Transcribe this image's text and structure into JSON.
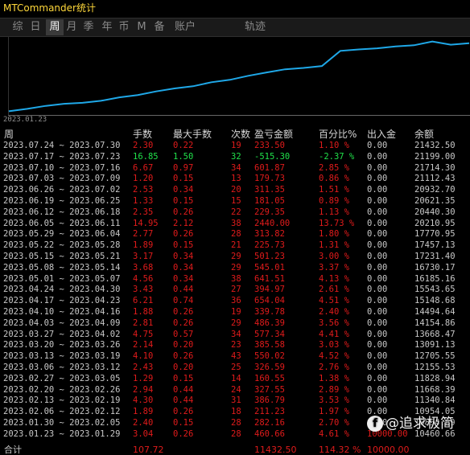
{
  "app": {
    "title": "MTCommander统计"
  },
  "tabs": [
    {
      "label": "综",
      "active": false
    },
    {
      "label": "日",
      "active": false
    },
    {
      "label": "周",
      "active": true
    },
    {
      "label": "月",
      "active": false
    },
    {
      "label": "季",
      "active": false
    },
    {
      "label": "年",
      "active": false
    },
    {
      "label": "币",
      "active": false
    },
    {
      "label": "M",
      "active": false
    },
    {
      "label": "备",
      "active": false
    },
    {
      "label": "账户",
      "active": false
    },
    {
      "label": "轨迹",
      "active": false
    }
  ],
  "chart": {
    "x_start_label": "2023.01.23",
    "line_color": "#1fa8e8",
    "balance_series": [
      10460.66,
      10854.69,
      11340.84,
      11668.39,
      11828.94,
      12155.53,
      12705.55,
      13091.13,
      13668.47,
      14154.86,
      14494.64,
      15148.68,
      15543.65,
      16185.16,
      16730.17,
      17231.4,
      17457.13,
      17770.95,
      20210.95,
      20440.3,
      20621.35,
      20932.7,
      21112.43,
      21714.3,
      21199.0,
      21432.5
    ]
  },
  "columns": {
    "week": "周",
    "lots": "手数",
    "max_lots": "最大手数",
    "count": "次数",
    "pnl": "盈亏金额",
    "percent": "百分比%",
    "deposit": "出入金",
    "balance": "余额"
  },
  "rows": [
    {
      "week": "2023.07.24 ~ 2023.07.30",
      "lots": "2.30",
      "max_lots": "0.22",
      "count": "19",
      "pnl": "233.50",
      "percent": "1.10 %",
      "deposit": "0.00",
      "balance": "21432.50",
      "color": "red"
    },
    {
      "week": "2023.07.17 ~ 2023.07.23",
      "lots": "16.85",
      "max_lots": "1.50",
      "count": "32",
      "pnl": "-515.30",
      "percent": "-2.37 %",
      "deposit": "0.00",
      "balance": "21199.00",
      "color": "green"
    },
    {
      "week": "2023.07.10 ~ 2023.07.16",
      "lots": "6.67",
      "max_lots": "0.97",
      "count": "34",
      "pnl": "601.87",
      "percent": "2.85 %",
      "deposit": "0.00",
      "balance": "21714.30",
      "color": "red"
    },
    {
      "week": "2023.07.03 ~ 2023.07.09",
      "lots": "1.20",
      "max_lots": "0.15",
      "count": "13",
      "pnl": "179.73",
      "percent": "0.86 %",
      "deposit": "0.00",
      "balance": "21112.43",
      "color": "red"
    },
    {
      "week": "2023.06.26 ~ 2023.07.02",
      "lots": "2.53",
      "max_lots": "0.34",
      "count": "20",
      "pnl": "311.35",
      "percent": "1.51 %",
      "deposit": "0.00",
      "balance": "20932.70",
      "color": "red"
    },
    {
      "week": "2023.06.19 ~ 2023.06.25",
      "lots": "1.33",
      "max_lots": "0.15",
      "count": "15",
      "pnl": "181.05",
      "percent": "0.89 %",
      "deposit": "0.00",
      "balance": "20621.35",
      "color": "red"
    },
    {
      "week": "2023.06.12 ~ 2023.06.18",
      "lots": "2.35",
      "max_lots": "0.26",
      "count": "22",
      "pnl": "229.35",
      "percent": "1.13 %",
      "deposit": "0.00",
      "balance": "20440.30",
      "color": "red"
    },
    {
      "week": "2023.06.05 ~ 2023.06.11",
      "lots": "14.95",
      "max_lots": "2.12",
      "count": "38",
      "pnl": "2440.00",
      "percent": "13.73 %",
      "deposit": "0.00",
      "balance": "20210.95",
      "color": "red"
    },
    {
      "week": "2023.05.29 ~ 2023.06.04",
      "lots": "2.77",
      "max_lots": "0.26",
      "count": "28",
      "pnl": "313.82",
      "percent": "1.80 %",
      "deposit": "0.00",
      "balance": "17770.95",
      "color": "red"
    },
    {
      "week": "2023.05.22 ~ 2023.05.28",
      "lots": "1.89",
      "max_lots": "0.15",
      "count": "21",
      "pnl": "225.73",
      "percent": "1.31 %",
      "deposit": "0.00",
      "balance": "17457.13",
      "color": "red"
    },
    {
      "week": "2023.05.15 ~ 2023.05.21",
      "lots": "3.17",
      "max_lots": "0.34",
      "count": "29",
      "pnl": "501.23",
      "percent": "3.00 %",
      "deposit": "0.00",
      "balance": "17231.40",
      "color": "red"
    },
    {
      "week": "2023.05.08 ~ 2023.05.14",
      "lots": "3.68",
      "max_lots": "0.34",
      "count": "29",
      "pnl": "545.01",
      "percent": "3.37 %",
      "deposit": "0.00",
      "balance": "16730.17",
      "color": "red"
    },
    {
      "week": "2023.05.01 ~ 2023.05.07",
      "lots": "4.56",
      "max_lots": "0.34",
      "count": "38",
      "pnl": "641.51",
      "percent": "4.13 %",
      "deposit": "0.00",
      "balance": "16185.16",
      "color": "red"
    },
    {
      "week": "2023.04.24 ~ 2023.04.30",
      "lots": "3.43",
      "max_lots": "0.44",
      "count": "27",
      "pnl": "394.97",
      "percent": "2.61 %",
      "deposit": "0.00",
      "balance": "15543.65",
      "color": "red"
    },
    {
      "week": "2023.04.17 ~ 2023.04.23",
      "lots": "6.21",
      "max_lots": "0.74",
      "count": "36",
      "pnl": "654.04",
      "percent": "4.51 %",
      "deposit": "0.00",
      "balance": "15148.68",
      "color": "red"
    },
    {
      "week": "2023.04.10 ~ 2023.04.16",
      "lots": "1.88",
      "max_lots": "0.26",
      "count": "19",
      "pnl": "339.78",
      "percent": "2.40 %",
      "deposit": "0.00",
      "balance": "14494.64",
      "color": "red"
    },
    {
      "week": "2023.04.03 ~ 2023.04.09",
      "lots": "2.81",
      "max_lots": "0.26",
      "count": "29",
      "pnl": "486.39",
      "percent": "3.56 %",
      "deposit": "0.00",
      "balance": "14154.86",
      "color": "red"
    },
    {
      "week": "2023.03.27 ~ 2023.04.02",
      "lots": "4.75",
      "max_lots": "0.57",
      "count": "34",
      "pnl": "577.34",
      "percent": "4.41 %",
      "deposit": "0.00",
      "balance": "13668.47",
      "color": "red"
    },
    {
      "week": "2023.03.20 ~ 2023.03.26",
      "lots": "2.14",
      "max_lots": "0.20",
      "count": "23",
      "pnl": "385.58",
      "percent": "3.03 %",
      "deposit": "0.00",
      "balance": "13091.13",
      "color": "red"
    },
    {
      "week": "2023.03.13 ~ 2023.03.19",
      "lots": "4.10",
      "max_lots": "0.26",
      "count": "43",
      "pnl": "550.02",
      "percent": "4.52 %",
      "deposit": "0.00",
      "balance": "12705.55",
      "color": "red"
    },
    {
      "week": "2023.03.06 ~ 2023.03.12",
      "lots": "2.43",
      "max_lots": "0.20",
      "count": "25",
      "pnl": "326.59",
      "percent": "2.76 %",
      "deposit": "0.00",
      "balance": "12155.53",
      "color": "red"
    },
    {
      "week": "2023.02.27 ~ 2023.03.05",
      "lots": "1.29",
      "max_lots": "0.15",
      "count": "14",
      "pnl": "160.55",
      "percent": "1.38 %",
      "deposit": "0.00",
      "balance": "11828.94",
      "color": "red"
    },
    {
      "week": "2023.02.20 ~ 2023.02.26",
      "lots": "2.94",
      "max_lots": "0.44",
      "count": "24",
      "pnl": "327.55",
      "percent": "2.89 %",
      "deposit": "0.00",
      "balance": "11668.39",
      "color": "red"
    },
    {
      "week": "2023.02.13 ~ 2023.02.19",
      "lots": "4.30",
      "max_lots": "0.44",
      "count": "31",
      "pnl": "386.79",
      "percent": "3.53 %",
      "deposit": "0.00",
      "balance": "11340.84",
      "color": "red"
    },
    {
      "week": "2023.02.06 ~ 2023.02.12",
      "lots": "1.89",
      "max_lots": "0.26",
      "count": "18",
      "pnl": "211.23",
      "percent": "1.97 %",
      "deposit": "0.00",
      "balance": "10954.05",
      "color": "red"
    },
    {
      "week": "2023.01.30 ~ 2023.02.05",
      "lots": "2.40",
      "max_lots": "0.15",
      "count": "28",
      "pnl": "282.16",
      "percent": "2.70 %",
      "deposit": "0.00",
      "balance": "10854.69",
      "color": "red"
    },
    {
      "week": "2023.01.23 ~ 2023.01.29",
      "lots": "3.04",
      "max_lots": "0.26",
      "count": "28",
      "pnl": "460.66",
      "percent": "4.61 %",
      "deposit": "10000.00",
      "balance": "10460.66",
      "color": "red"
    }
  ],
  "total": {
    "label": "合计",
    "lots": "107.72",
    "pnl": "11432.50",
    "percent": "114.32 %",
    "deposit": "10000.00"
  },
  "watermark": {
    "logo_glyph": "f",
    "text": "@追求极简"
  }
}
